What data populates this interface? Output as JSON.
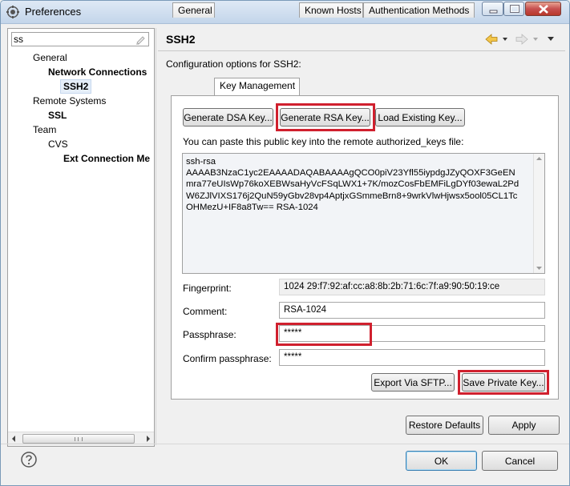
{
  "window": {
    "title": "Preferences"
  },
  "filter": {
    "value": "ss"
  },
  "tree": [
    {
      "label": "General",
      "bold": false,
      "indent": 0
    },
    {
      "label": "Network Connections",
      "bold": true,
      "indent": 1
    },
    {
      "label": "SSH2",
      "bold": true,
      "indent": 2,
      "selected": true
    },
    {
      "label": "Remote Systems",
      "bold": false,
      "indent": 0
    },
    {
      "label": "SSL",
      "bold": true,
      "indent": 1
    },
    {
      "label": "Team",
      "bold": false,
      "indent": 0
    },
    {
      "label": "CVS",
      "bold": false,
      "indent": 1
    },
    {
      "label": "Ext Connection Me",
      "bold": true,
      "indent": 2
    }
  ],
  "page": {
    "title": "SSH2",
    "description": "Configuration options for SSH2:"
  },
  "tabs": [
    "General",
    "Key Management",
    "Known Hosts",
    "Authentication Methods"
  ],
  "active_tab": "Key Management",
  "key_mgmt": {
    "gen_dsa": "Generate DSA Key...",
    "gen_rsa": "Generate RSA Key...",
    "load_key": "Load Existing Key...",
    "paste_hint": "You can paste this public key into the remote authorized_keys file:",
    "public_key": "ssh-rsa\nAAAAB3NzaC1yc2EAAAADAQABAAAAgQCO0piV23Yfl55iypdgJZyQOXF3GeEN\nmra77eUIsWp76koXEBWsaHyVcFSqLWX1+7K/mozCosFbEMFiLgDYf03ewaL2Pd\nW6ZJlVIXS176j2QuN59yGbv28vp4AptjxGSmmeBrn8+9wrkVlwHjwsx5ool05CL1Tc\nOHMezU+IF8a8Tw== RSA-1024",
    "fingerprint_label": "Fingerprint:",
    "fingerprint_value": "1024 29:f7:92:af:cc:a8:8b:2b:71:6c:7f:a9:90:50:19:ce",
    "comment_label": "Comment:",
    "comment_value": "RSA-1024",
    "passphrase_label": "Passphrase:",
    "passphrase_value": "*****",
    "confirm_label": "Confirm passphrase:",
    "confirm_value": "*****",
    "export_sftp": "Export Via SFTP...",
    "save_private": "Save Private Key..."
  },
  "buttons": {
    "restore_defaults": "Restore Defaults",
    "apply": "Apply",
    "ok": "OK",
    "cancel": "Cancel"
  },
  "colors": {
    "highlight": "#d0202e"
  }
}
